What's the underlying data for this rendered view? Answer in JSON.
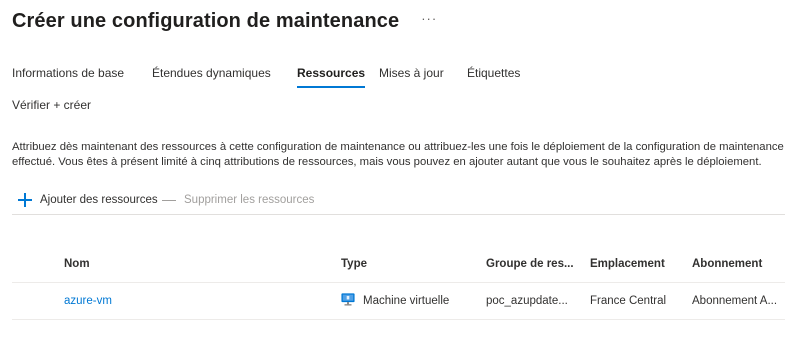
{
  "header": {
    "title": "Créer une configuration de maintenance",
    "more_label": "···"
  },
  "tabs": [
    {
      "label": "Informations de base",
      "active": false
    },
    {
      "label": "Étendues dynamiques",
      "active": false
    },
    {
      "label": "Ressources",
      "active": true
    },
    {
      "label": "Mises à jour",
      "active": false
    },
    {
      "label": "Étiquettes",
      "active": false
    },
    {
      "label": "Vérifier + créer",
      "active": false
    }
  ],
  "description": "Attribuez dès maintenant des ressources à cette configuration de maintenance ou attribuez-les une fois le déploiement de la configuration de maintenance effectué. Vous êtes à présent limité à cinq attributions de ressources, mais vous pouvez en ajouter autant que vous le souhaitez après le déploiement.",
  "commandbar": {
    "add_label": "Ajouter des ressources",
    "remove_label": "Supprimer les ressources"
  },
  "grid": {
    "columns": [
      "Nom",
      "Type",
      "Groupe de res...",
      "Emplacement",
      "Abonnement"
    ],
    "rows": [
      {
        "name": "azure-vm",
        "type": "Machine virtuelle",
        "type_icon": "virtual-machine-icon",
        "resource_group": "poc_azupdate...",
        "location": "France Central",
        "subscription": "Abonnement A..."
      }
    ]
  },
  "colors": {
    "accent": "#0078d4",
    "text": "#323130",
    "disabled": "#a19f9d"
  }
}
